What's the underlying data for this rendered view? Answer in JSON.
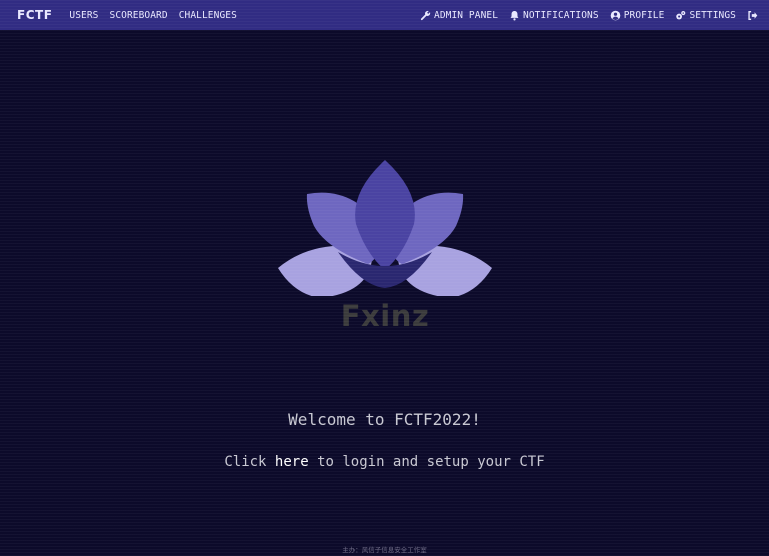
{
  "navbar": {
    "brand": "FCTF",
    "left_links": [
      "USERS",
      "SCOREBOARD",
      "CHALLENGES"
    ],
    "right_links": [
      {
        "label": "ADMIN PANEL",
        "icon": "wrench-icon"
      },
      {
        "label": "NOTIFICATIONS",
        "icon": "bell-icon"
      },
      {
        "label": "PROFILE",
        "icon": "user-circle-icon"
      },
      {
        "label": "SETTINGS",
        "icon": "gears-icon"
      },
      {
        "label": "",
        "icon": "logout-icon"
      }
    ]
  },
  "logo": {
    "text": "Fxinz"
  },
  "main": {
    "welcome": "Welcome to FCTF2022!",
    "login_prefix": "Click ",
    "login_link": "here",
    "login_suffix": " to login and setup your CTF"
  },
  "footer": {
    "text": "主办：风信子信息安全工作室"
  },
  "colors": {
    "navbar_bg": "#312c83",
    "page_bg": "#0c0a2a",
    "petal_dark": "#4a43a2",
    "petal_mid": "#6e67c0",
    "petal_light": "#a8a2e0"
  }
}
